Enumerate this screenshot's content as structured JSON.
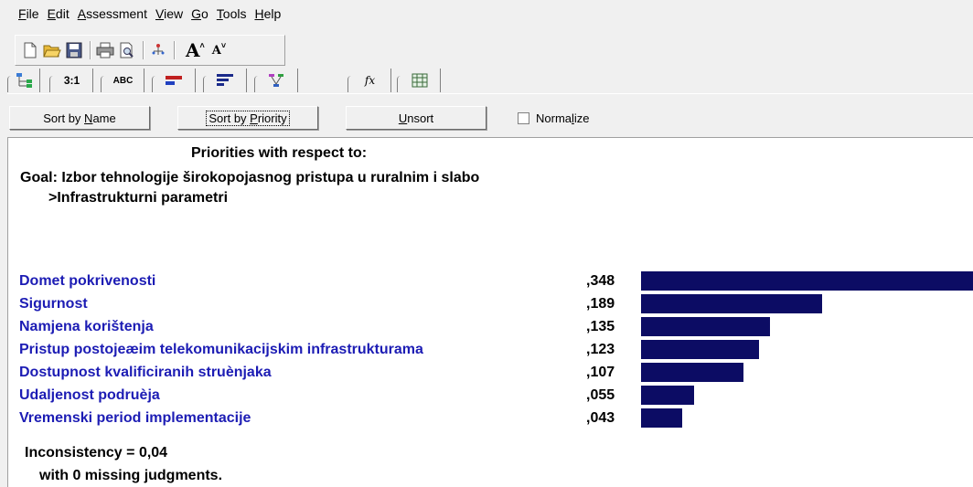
{
  "menu": [
    {
      "label": "File",
      "acc": "F",
      "rest": "ile"
    },
    {
      "label": "Edit",
      "acc": "E",
      "rest": "dit"
    },
    {
      "label": "Assessment",
      "acc": "A",
      "rest": "ssessment"
    },
    {
      "label": "View",
      "acc": "V",
      "rest": "iew"
    },
    {
      "label": "Go",
      "acc": "G",
      "rest": "o"
    },
    {
      "label": "Tools",
      "acc": "T",
      "rest": "ools"
    },
    {
      "label": "Help",
      "acc": "H",
      "rest": "elp"
    }
  ],
  "toolbar": {
    "icons": [
      "new-file-icon",
      "open-folder-icon",
      "save-icon",
      "print-icon",
      "print-preview-icon",
      "tree-icon"
    ],
    "font_increase": "A",
    "font_decrease": "A"
  },
  "tabs": [
    {
      "name": "tree-view",
      "icon": "tree-icon",
      "label": ""
    },
    {
      "name": "numerical",
      "label": "3:1"
    },
    {
      "name": "verbal",
      "label": "ABC"
    },
    {
      "name": "graphical",
      "icon": "bar-graph-icon",
      "label": ""
    },
    {
      "name": "priorities",
      "icon": "priorities-icon",
      "label": ""
    },
    {
      "name": "synthesis",
      "icon": "synthesis-icon",
      "label": ""
    },
    {
      "name": "formula",
      "label": "fx"
    },
    {
      "name": "spreadsheet",
      "icon": "grid-icon",
      "label": ""
    }
  ],
  "sortbar": {
    "sort_by_name": {
      "acc_pre": "Sort by ",
      "acc": "N",
      "acc_post": "ame"
    },
    "sort_by_priority": {
      "acc_pre": "Sort by ",
      "acc": "P",
      "acc_post": "riority"
    },
    "unsort": {
      "acc_pre": "",
      "acc": "U",
      "acc_post": "nsort"
    },
    "normalize": {
      "acc_pre": "Norma",
      "acc": "l",
      "acc_post": "ize",
      "checked": false
    }
  },
  "content": {
    "heading": "Priorities with respect to:",
    "goal": "Goal: Izbor tehnologije širokopojasnog pristupa u ruralnim i slabo",
    "sub": ">Infrastrukturni parametri",
    "criteria": [
      {
        "label": "Domet pokrivenosti",
        "value": ",348",
        "priority": 0.348
      },
      {
        "label": "Sigurnost",
        "value": ",189",
        "priority": 0.189
      },
      {
        "label": "Namjena korištenja",
        "value": ",135",
        "priority": 0.135
      },
      {
        "label": "Pristup postojeæim telekomunikacijskim infrastrukturama",
        "value": ",123",
        "priority": 0.123
      },
      {
        "label": "Dostupnost kvalificiranih struènjaka",
        "value": ",107",
        "priority": 0.107
      },
      {
        "label": "Udaljenost podruèja",
        "value": ",055",
        "priority": 0.055
      },
      {
        "label": "Vremenski period implementacije",
        "value": ",043",
        "priority": 0.043
      }
    ],
    "inconsistency": "Inconsistency = 0,04",
    "missing": "with 0  missing judgments."
  },
  "colors": {
    "bar": "#0c0c64",
    "label": "#1c1cb4"
  }
}
